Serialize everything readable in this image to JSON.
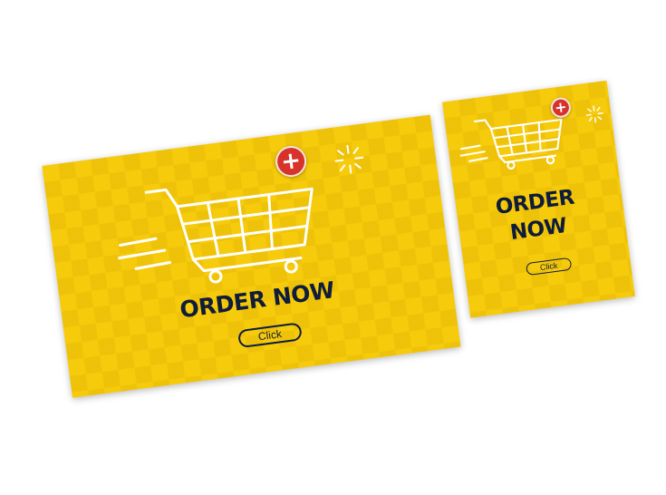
{
  "colors": {
    "background": "#ffffff",
    "banner_yellow": "#f6cb0b",
    "text_navy": "#0f1c3a",
    "badge_red": "#d8332b",
    "cart_stroke": "#ffffff"
  },
  "banner_large": {
    "headline": "ORDER NOW",
    "button_label": "Click",
    "badge": "+",
    "icon": "shopping-cart-icon"
  },
  "banner_small": {
    "headline": "ORDER NOW",
    "button_label": "Click",
    "badge": "+",
    "icon": "shopping-cart-icon"
  }
}
